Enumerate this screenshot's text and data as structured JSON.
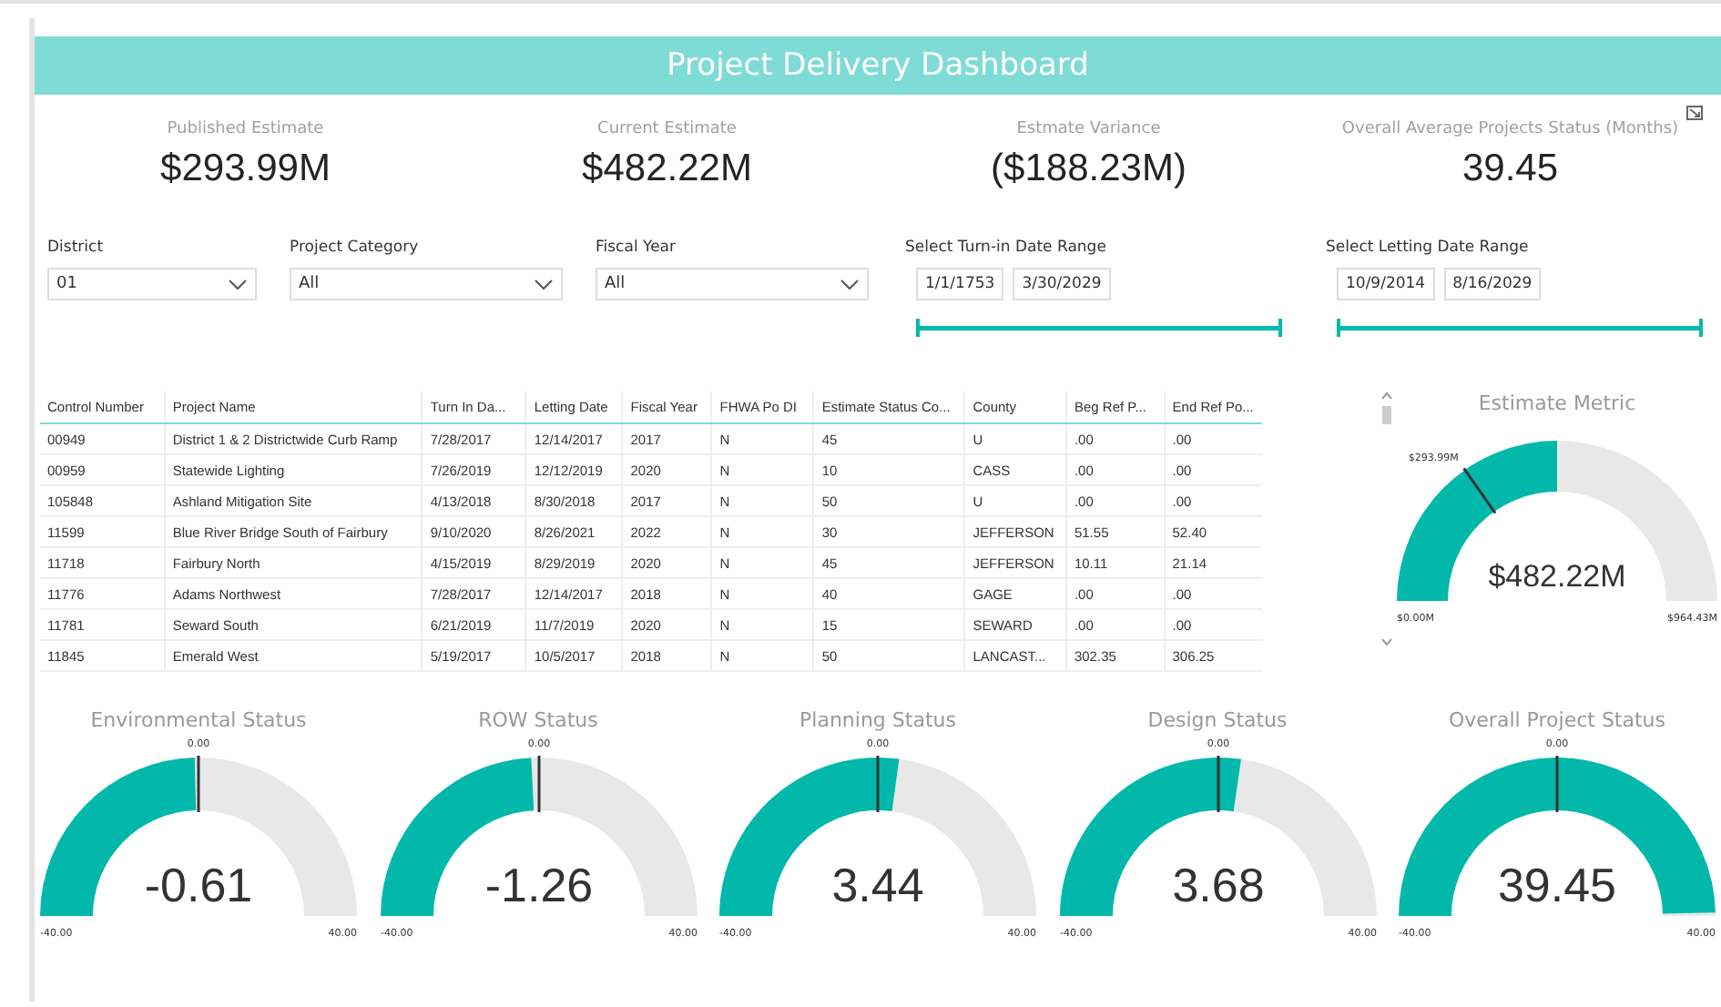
{
  "title": "Project Delivery Dashboard",
  "kpis": [
    {
      "label": "Published Estimate",
      "value": "$293.99M"
    },
    {
      "label": "Current Estimate",
      "value": "$482.22M"
    },
    {
      "label": "Estmate Variance",
      "value": "($188.23M)"
    },
    {
      "label": "Overall Average Projects Status (Months)",
      "value": "39.45"
    }
  ],
  "dropdowns": [
    {
      "label": "District",
      "value": "01"
    },
    {
      "label": "Project Category",
      "value": "All"
    },
    {
      "label": "Fiscal Year",
      "value": "All"
    }
  ],
  "date_ranges": [
    {
      "label": "Select Turn-in Date Range",
      "start": "1/1/1753",
      "end": "3/30/2029"
    },
    {
      "label": "Select Letting Date Range",
      "start": "10/9/2014",
      "end": "8/16/2029"
    }
  ],
  "table": {
    "columns": [
      "Control Number",
      "Project Name",
      "Turn In Da...",
      "Letting Date",
      "Fiscal Year",
      "FHWA Po DI",
      "Estimate Status Co...",
      "County",
      "Beg Ref P...",
      "End Ref Po..."
    ],
    "rows": [
      [
        "00949",
        "District 1 & 2 Districtwide Curb Ramp",
        "7/28/2017",
        "12/14/2017",
        "2017",
        "N",
        "45",
        "U",
        ".00",
        ".00"
      ],
      [
        "00959",
        "Statewide Lighting",
        "7/26/2019",
        "12/12/2019",
        "2020",
        "N",
        "10",
        "CASS",
        ".00",
        ".00"
      ],
      [
        "105848",
        "Ashland Mitigation Site",
        "4/13/2018",
        "8/30/2018",
        "2017",
        "N",
        "50",
        "U",
        ".00",
        ".00"
      ],
      [
        "11599",
        "Blue River Bridge South of Fairbury",
        "9/10/2020",
        "8/26/2021",
        "2022",
        "N",
        "30",
        "JEFFERSON",
        "51.55",
        "52.40"
      ],
      [
        "11718",
        "Fairbury North",
        "4/15/2019",
        "8/29/2019",
        "2020",
        "N",
        "45",
        "JEFFERSON",
        "10.11",
        "21.14"
      ],
      [
        "11776",
        "Adams Northwest",
        "7/28/2017",
        "12/14/2017",
        "2018",
        "N",
        "40",
        "GAGE",
        ".00",
        ".00"
      ],
      [
        "11781",
        "Seward South",
        "6/21/2019",
        "11/7/2019",
        "2020",
        "N",
        "15",
        "SEWARD",
        ".00",
        ".00"
      ],
      [
        "11845",
        "Emerald West",
        "5/19/2017",
        "10/5/2017",
        "2018",
        "N",
        "50",
        "LANCAST...",
        "302.35",
        "306.25"
      ]
    ]
  },
  "estimate_metric": {
    "title": "Estimate Metric",
    "value": "$482.22M",
    "min": "$0.00M",
    "max": "$964.43M",
    "target": "$293.99M"
  },
  "status_gauges": [
    {
      "title": "Environmental Status",
      "value": "-0.61",
      "min": "-40.00",
      "max": "40.00",
      "target": "0.00"
    },
    {
      "title": "ROW Status",
      "value": "-1.26",
      "min": "-40.00",
      "max": "40.00",
      "target": "0.00"
    },
    {
      "title": "Planning Status",
      "value": "3.44",
      "min": "-40.00",
      "max": "40.00",
      "target": "0.00"
    },
    {
      "title": "Design Status",
      "value": "3.68",
      "min": "-40.00",
      "max": "40.00",
      "target": "0.00"
    },
    {
      "title": "Overall Project Status",
      "value": "39.45",
      "min": "-40.00",
      "max": "40.00",
      "target": "0.00"
    }
  ]
}
